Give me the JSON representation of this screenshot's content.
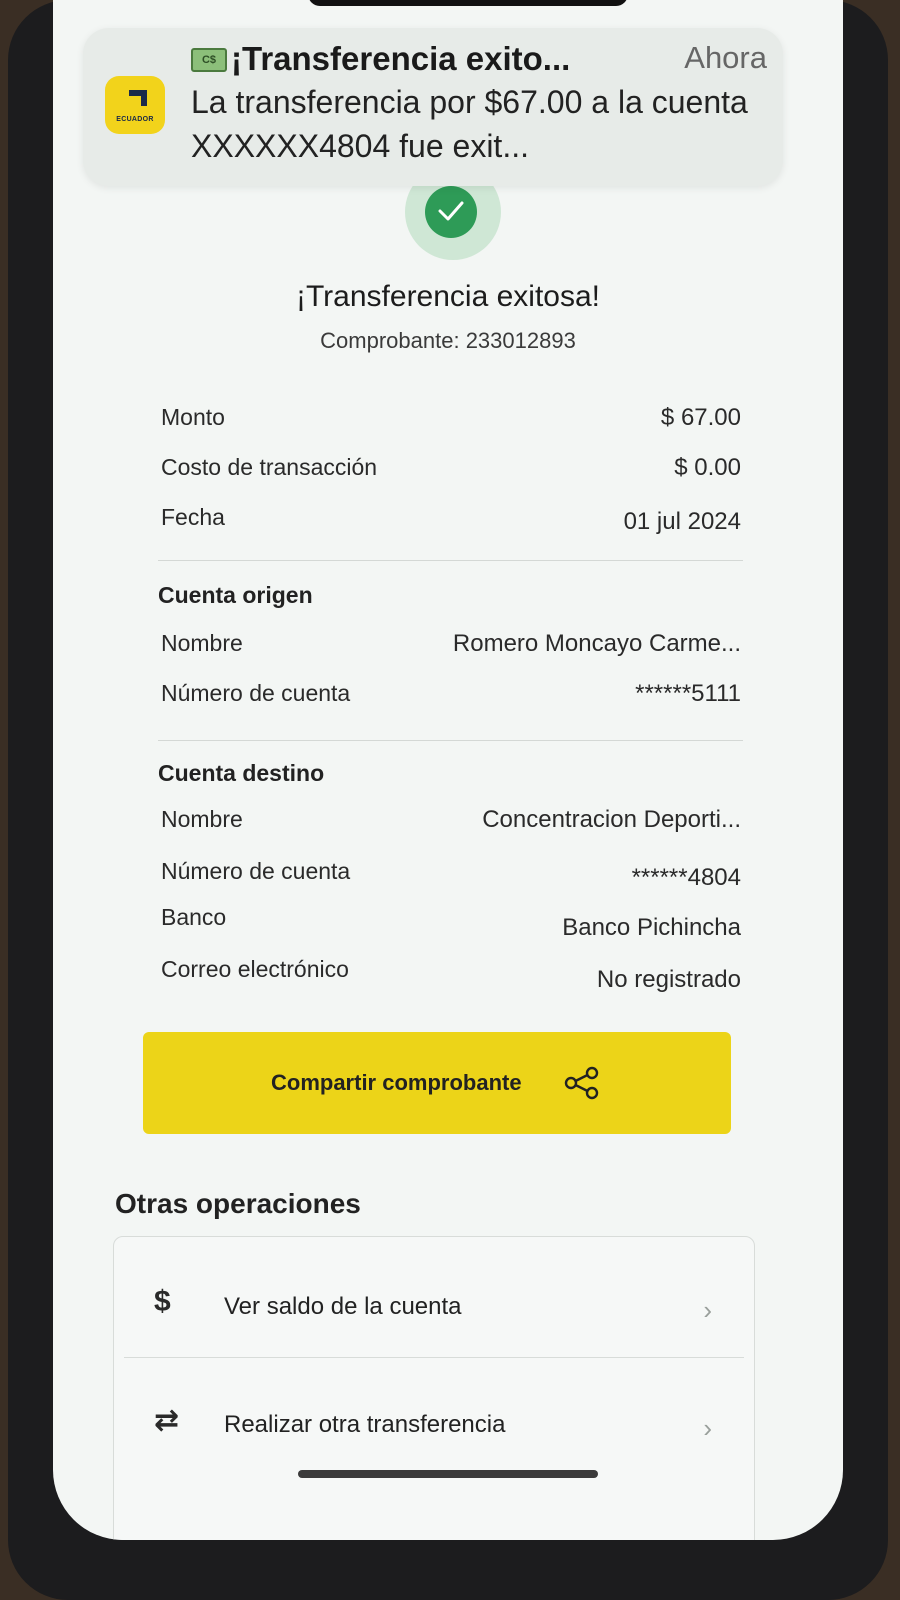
{
  "notification": {
    "title": "¡Transferencia exito...",
    "time": "Ahora",
    "body": "La transferencia por $67.00 a la cuenta  XXXXXX4804 fue exit...",
    "app_region": "ECUADOR",
    "emoji_text": "C$"
  },
  "receipt": {
    "title": "¡Transferencia exitosa!",
    "voucher": "Comprobante: 233012893",
    "summary": [
      {
        "label": "Monto",
        "value": "$ 67.00"
      },
      {
        "label": "Costo de transacción",
        "value": "$ 0.00"
      },
      {
        "label": "Fecha",
        "value": "01 jul 2024"
      }
    ],
    "origin": {
      "heading": "Cuenta origen",
      "rows": [
        {
          "label": "Nombre",
          "value": "Romero  Moncayo Carme..."
        },
        {
          "label": "Número de cuenta",
          "value": "******5111"
        }
      ]
    },
    "destination": {
      "heading": "Cuenta destino",
      "rows": [
        {
          "label": "Nombre",
          "value": "Concentracion Deporti..."
        },
        {
          "label": "Número de cuenta",
          "value": "******4804"
        },
        {
          "label": "Banco",
          "value": "Banco Pichincha"
        },
        {
          "label": "Correo electrónico",
          "value": "No registrado"
        }
      ]
    }
  },
  "share_button": {
    "label": "Compartir comprobante"
  },
  "other_operations": {
    "title": "Otras operaciones",
    "items": [
      {
        "icon": "dollar-icon",
        "glyph": "$",
        "label": "Ver saldo de la cuenta"
      },
      {
        "icon": "transfer-arrows-icon",
        "glyph": "⇄",
        "label": "Realizar otra transferencia"
      }
    ]
  },
  "colors": {
    "brand_yellow": "#ecd418",
    "success_green": "#2e9b57"
  }
}
